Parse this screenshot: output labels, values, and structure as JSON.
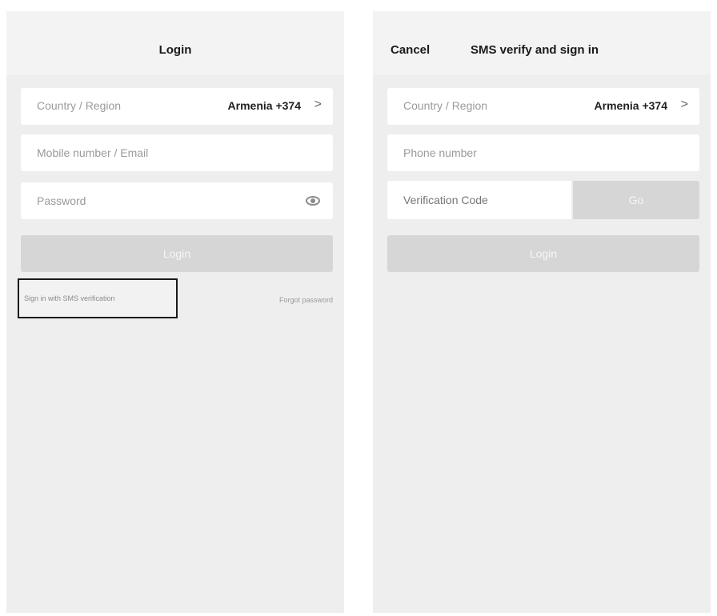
{
  "login": {
    "title": "Login",
    "country_label": "Country / Region",
    "country_value": "Armenia +374",
    "chevron": ">",
    "mobile_placeholder": "Mobile number / Email",
    "password_placeholder": "Password",
    "login_button": "Login",
    "sms_link": "Sign in with SMS verification",
    "forgot_link": "Forgot password"
  },
  "sms": {
    "cancel": "Cancel",
    "title": "SMS verify and sign in",
    "country_label": "Country / Region",
    "country_value": "Armenia +374",
    "chevron": ">",
    "phone_placeholder": "Phone number",
    "code_placeholder": "Verification Code",
    "go_button": "Go",
    "login_button": "Login"
  },
  "colors": {
    "background": "#eeeeee",
    "field": "#ffffff",
    "button_disabled": "#d6d6d6",
    "highlight_border": "#1a1a1a"
  }
}
